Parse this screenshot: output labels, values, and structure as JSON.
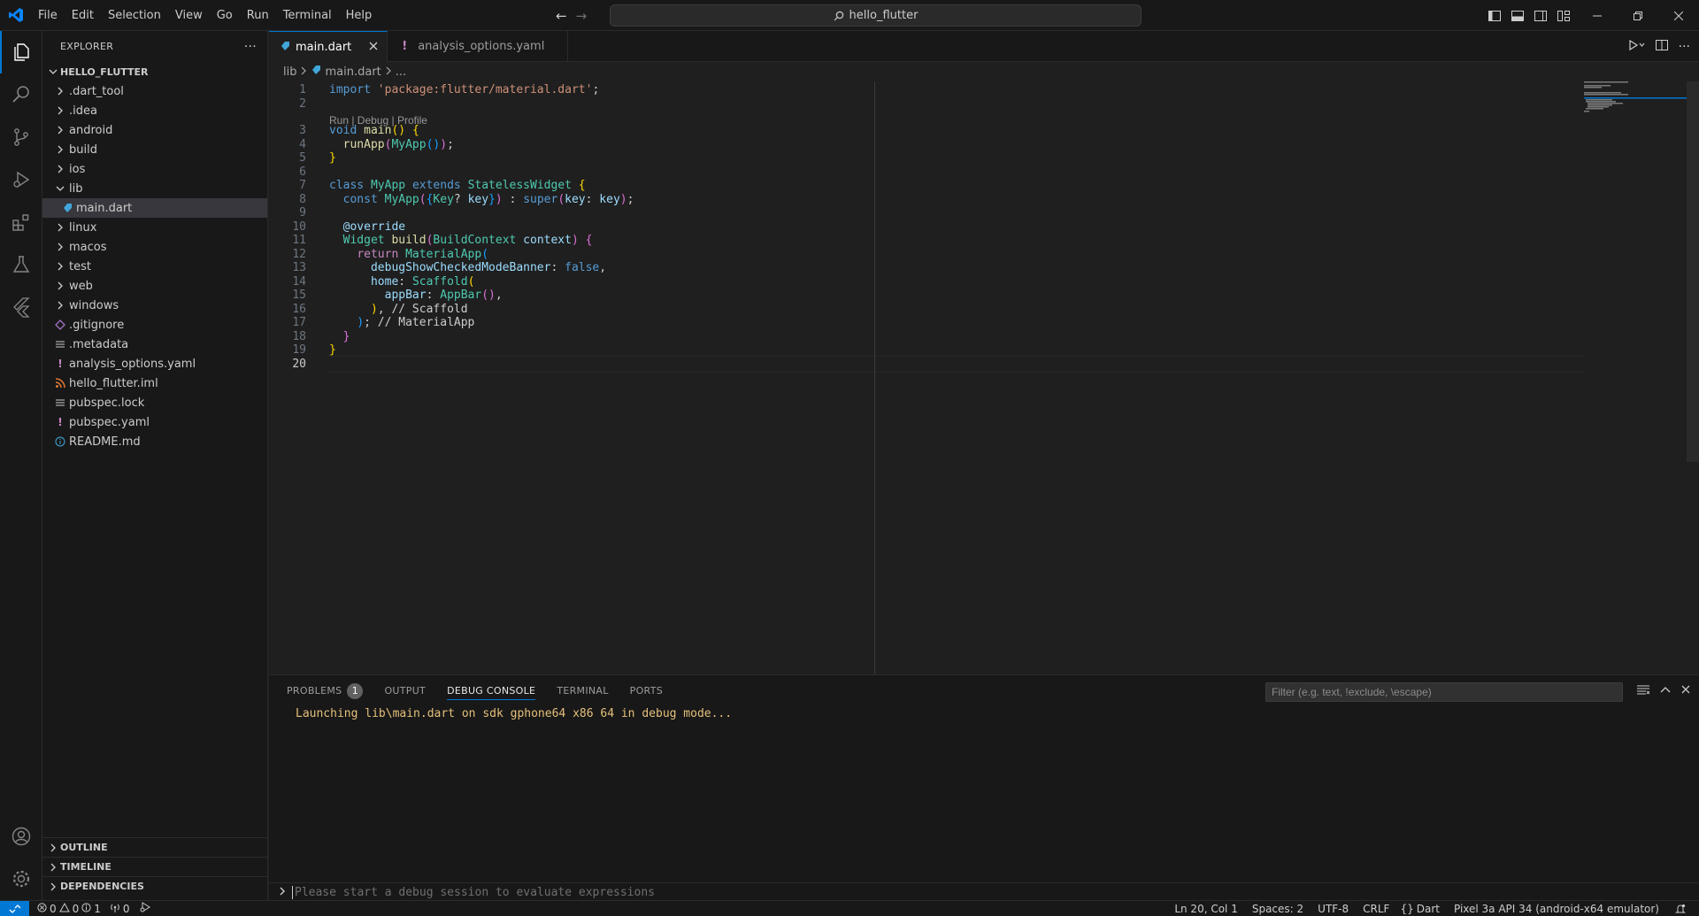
{
  "menu": [
    "File",
    "Edit",
    "Selection",
    "View",
    "Go",
    "Run",
    "Terminal",
    "Help"
  ],
  "search": {
    "label": "hello_flutter"
  },
  "sidebar": {
    "title": "EXPLORER",
    "root": "HELLO_FLUTTER",
    "items": [
      {
        "label": ".dart_tool",
        "type": "folder",
        "depth": 1,
        "open": false
      },
      {
        "label": ".idea",
        "type": "folder",
        "depth": 1,
        "open": false
      },
      {
        "label": "android",
        "type": "folder",
        "depth": 1,
        "open": false
      },
      {
        "label": "build",
        "type": "folder",
        "depth": 1,
        "open": false
      },
      {
        "label": "ios",
        "type": "folder",
        "depth": 1,
        "open": false
      },
      {
        "label": "lib",
        "type": "folder",
        "depth": 1,
        "open": true
      },
      {
        "label": "main.dart",
        "type": "dart",
        "depth": 2,
        "selected": true
      },
      {
        "label": "linux",
        "type": "folder",
        "depth": 1,
        "open": false
      },
      {
        "label": "macos",
        "type": "folder",
        "depth": 1,
        "open": false
      },
      {
        "label": "test",
        "type": "folder",
        "depth": 1,
        "open": false
      },
      {
        "label": "web",
        "type": "folder",
        "depth": 1,
        "open": false
      },
      {
        "label": "windows",
        "type": "folder",
        "depth": 1,
        "open": false
      },
      {
        "label": ".gitignore",
        "type": "git",
        "depth": 1
      },
      {
        "label": ".metadata",
        "type": "lines",
        "depth": 1
      },
      {
        "label": "analysis_options.yaml",
        "type": "yaml",
        "depth": 1
      },
      {
        "label": "hello_flutter.iml",
        "type": "rss",
        "depth": 1
      },
      {
        "label": "pubspec.lock",
        "type": "lines",
        "depth": 1
      },
      {
        "label": "pubspec.yaml",
        "type": "yaml",
        "depth": 1
      },
      {
        "label": "README.md",
        "type": "info",
        "depth": 1
      }
    ],
    "sections": [
      "OUTLINE",
      "TIMELINE",
      "DEPENDENCIES"
    ]
  },
  "tabs": [
    {
      "label": "main.dart",
      "active": true
    },
    {
      "label": "analysis_options.yaml",
      "active": false
    }
  ],
  "breadcrumbs": [
    "lib",
    "main.dart",
    "..."
  ],
  "codelens": "Run | Debug | Profile",
  "code_lines": [
    {
      "n": "1",
      "tokens": [
        [
          "import ",
          "kw"
        ],
        [
          "'package:flutter/material.dart'",
          "str"
        ],
        [
          ";",
          "plain"
        ]
      ]
    },
    {
      "n": "2",
      "tokens": []
    },
    {
      "n": "3",
      "tokens": [
        [
          "void ",
          "kw"
        ],
        [
          "main",
          "fn"
        ],
        [
          "() ",
          "br1"
        ],
        [
          "{",
          "br1"
        ]
      ]
    },
    {
      "n": "4",
      "tokens": [
        [
          "  ",
          "plain"
        ],
        [
          "runApp",
          "fn"
        ],
        [
          "(",
          "br2"
        ],
        [
          "MyApp",
          "ty"
        ],
        [
          "()",
          "br3"
        ],
        [
          ")",
          "br2"
        ],
        [
          ";",
          "plain"
        ]
      ]
    },
    {
      "n": "5",
      "tokens": [
        [
          "}",
          "br1"
        ]
      ]
    },
    {
      "n": "6",
      "tokens": []
    },
    {
      "n": "7",
      "tokens": [
        [
          "class ",
          "kw"
        ],
        [
          "MyApp ",
          "ty"
        ],
        [
          "extends ",
          "kw"
        ],
        [
          "StatelessWidget ",
          "ty"
        ],
        [
          "{",
          "br1"
        ]
      ]
    },
    {
      "n": "8",
      "tokens": [
        [
          "  ",
          "plain"
        ],
        [
          "const ",
          "kw"
        ],
        [
          "MyApp",
          "ty"
        ],
        [
          "(",
          "br2"
        ],
        [
          "{",
          "br3"
        ],
        [
          "Key",
          "ty"
        ],
        [
          "? ",
          "plain"
        ],
        [
          "key",
          "var"
        ],
        [
          "}",
          "br3"
        ],
        [
          ") ",
          "br2"
        ],
        [
          ": ",
          "plain"
        ],
        [
          "super",
          "kw"
        ],
        [
          "(",
          "br2"
        ],
        [
          "key",
          "var"
        ],
        [
          ": ",
          "plain"
        ],
        [
          "key",
          "var"
        ],
        [
          ")",
          "br2"
        ],
        [
          ";",
          "plain"
        ]
      ]
    },
    {
      "n": "9",
      "tokens": []
    },
    {
      "n": "10",
      "tokens": [
        [
          "  ",
          "plain"
        ],
        [
          "@override",
          "var"
        ]
      ]
    },
    {
      "n": "11",
      "tokens": [
        [
          "  ",
          "plain"
        ],
        [
          "Widget ",
          "ty"
        ],
        [
          "build",
          "fn"
        ],
        [
          "(",
          "br2"
        ],
        [
          "BuildContext ",
          "ty"
        ],
        [
          "context",
          "var"
        ],
        [
          ") ",
          "br2"
        ],
        [
          "{",
          "br2"
        ]
      ]
    },
    {
      "n": "12",
      "tokens": [
        [
          "    ",
          "plain"
        ],
        [
          "return ",
          "ctl"
        ],
        [
          "MaterialApp",
          "ty"
        ],
        [
          "(",
          "br3"
        ]
      ]
    },
    {
      "n": "13",
      "tokens": [
        [
          "      ",
          "plain"
        ],
        [
          "debugShowCheckedModeBanner",
          "var"
        ],
        [
          ": ",
          "plain"
        ],
        [
          "false",
          "kw"
        ],
        [
          ",",
          "plain"
        ]
      ]
    },
    {
      "n": "14",
      "tokens": [
        [
          "      ",
          "plain"
        ],
        [
          "home",
          "var"
        ],
        [
          ": ",
          "plain"
        ],
        [
          "Scaffold",
          "ty"
        ],
        [
          "(",
          "br1"
        ]
      ]
    },
    {
      "n": "15",
      "tokens": [
        [
          "        ",
          "plain"
        ],
        [
          "appBar",
          "var"
        ],
        [
          ": ",
          "plain"
        ],
        [
          "AppBar",
          "ty"
        ],
        [
          "()",
          "br2"
        ],
        [
          ",",
          "plain"
        ]
      ]
    },
    {
      "n": "16",
      "tokens": [
        [
          "      ",
          "plain"
        ],
        [
          ")",
          "br1"
        ],
        [
          ", ",
          "plain"
        ],
        [
          "// Scaffold",
          "cmg"
        ]
      ]
    },
    {
      "n": "17",
      "tokens": [
        [
          "    ",
          "plain"
        ],
        [
          ")",
          "br3"
        ],
        [
          "; ",
          "plain"
        ],
        [
          "// MaterialApp",
          "cmg"
        ]
      ]
    },
    {
      "n": "18",
      "tokens": [
        [
          "  ",
          "plain"
        ],
        [
          "}",
          "br2"
        ]
      ]
    },
    {
      "n": "19",
      "tokens": [
        [
          "}",
          "br1"
        ]
      ]
    },
    {
      "n": "20",
      "tokens": [],
      "current": true
    }
  ],
  "panel": {
    "tabs": [
      {
        "label": "PROBLEMS",
        "badge": "1"
      },
      {
        "label": "OUTPUT"
      },
      {
        "label": "DEBUG CONSOLE",
        "active": true
      },
      {
        "label": "TERMINAL"
      },
      {
        "label": "PORTS"
      }
    ],
    "filter_placeholder": "Filter (e.g. text, !exclude, \\escape)",
    "output_line": "Launching lib\\main.dart on sdk gphone64 x86 64 in debug mode...",
    "input_placeholder": "Please start a debug session to evaluate expressions"
  },
  "status": {
    "errors": "0",
    "warnings": "0",
    "info": "1",
    "ports": "0",
    "position": "Ln 20, Col 1",
    "spaces": "Spaces: 2",
    "encoding": "UTF-8",
    "eol": "CRLF",
    "language": "Dart",
    "device": "Pixel 3a API 34 (android-x64 emulator)"
  },
  "colors": {
    "accent": "#0078d4",
    "background": "#1f1f1f",
    "chrome": "#181818"
  }
}
